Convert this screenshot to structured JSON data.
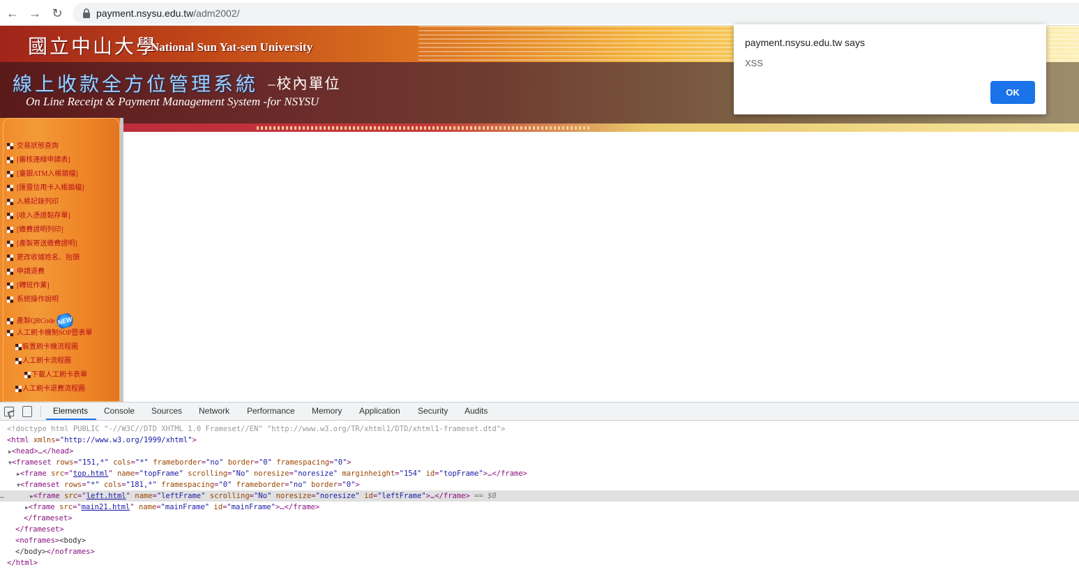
{
  "browser": {
    "url_domain": "payment.nsysu.edu.tw",
    "url_path": "/adm2002/",
    "back_icon": "←",
    "forward_icon": "→",
    "reload_icon": "↻"
  },
  "banner": {
    "university_cn": "國立中山大學",
    "university_en": "National Sun Yat-sen University",
    "system_cn": "線上收款全方位管理系統",
    "system_cn_suffix": "–校內單位",
    "system_en": "On Line  Receipt & Payment Management System -for NSYSU"
  },
  "menu": {
    "items": [
      {
        "label": "交易狀態查詢"
      },
      {
        "label": "[審核連線申請表]"
      },
      {
        "label": "[臺銀ATM入帳鎖檔]"
      },
      {
        "label": "[匯豐信用卡入帳鎖檔]"
      },
      {
        "label": "入帳記錄列印"
      },
      {
        "label": "[收入憑證黏存單]"
      },
      {
        "label": "[繳費證明列印]"
      },
      {
        "label": "[產製寄送繳費證明]"
      },
      {
        "label": "更改收據姓名、抬頭"
      },
      {
        "label": "申請退費"
      },
      {
        "label": "[轉班作業]"
      },
      {
        "label": "系統操作說明"
      },
      {
        "label": "產製QRCode"
      },
      {
        "label": "人工刷卡機制SOP暨表單"
      },
      {
        "label": "裝置刷卡機流程圖"
      },
      {
        "label": "人工刷卡流程圖"
      },
      {
        "label": "下載人工刷卡表單"
      },
      {
        "label": "人工刷卡退費流程圖"
      }
    ],
    "new_badge": "NEW"
  },
  "alert": {
    "title": "payment.nsysu.edu.tw says",
    "message": "XSS",
    "ok_label": "OK"
  },
  "devtools": {
    "tabs": [
      "Elements",
      "Console",
      "Sources",
      "Network",
      "Performance",
      "Memory",
      "Application",
      "Security",
      "Audits"
    ],
    "dom": {
      "l0": "<!doctype html PUBLIC \"-//W3C//DTD XHTML 1.0 Frameset//EN\" \"http://www.w3.org/TR/xhtml1/DTD/xhtml1-frameset.dtd\">",
      "l1_tag_open": "<html ",
      "l1_attr": "xmlns",
      "l1_val": "\"http://www.w3.org/1999/xhtml\"",
      "l1_tag_close": ">",
      "l2": "<head>…</head>",
      "l3_a": "<frameset ",
      "l3_rows": "rows",
      "l3_rows_v": "\"151,*\"",
      "l3_cols": "cols",
      "l3_cols_v": "\"*\"",
      "l3_fb": "frameborder",
      "l3_fb_v": "\"no\"",
      "l3_b": "border",
      "l3_b_v": "\"0\"",
      "l3_fs": "framespacing",
      "l3_fs_v": "\"0\"",
      "l4_src_v": "top.html",
      "l4_name_v": "\"topFrame\"",
      "l4_scroll_v": "\"No\"",
      "l4_noresize_v": "\"noresize\"",
      "l4_mh_v": "\"154\"",
      "l4_id_v": "\"topFrame\"",
      "l5_rows_v": "\"*\"",
      "l5_cols_v": "\"181,*\"",
      "l5_fs_v": "\"0\"",
      "l5_fb_v": "\"no\"",
      "l5_b_v": "\"0\"",
      "l6_src_v": "left.html",
      "l6_name_v": "\"leftFrame\"",
      "l6_scroll_v": "\"No\"",
      "l6_noresize_v": "\"noresize\"",
      "l6_id_v": "\"leftFrame\"",
      "l6_eq": "== $0",
      "l7_src_v": "main21.html",
      "l7_name_v": "\"mainFrame\"",
      "l7_id_v": "\"mainFrame\"",
      "l8": "</frameset>",
      "l9": "</frameset>",
      "l10_a": "<noframes>",
      "l10_b": "<body>",
      "l11_a": "</body>",
      "l11_b": "</noframes>",
      "l12": "</html>"
    }
  }
}
